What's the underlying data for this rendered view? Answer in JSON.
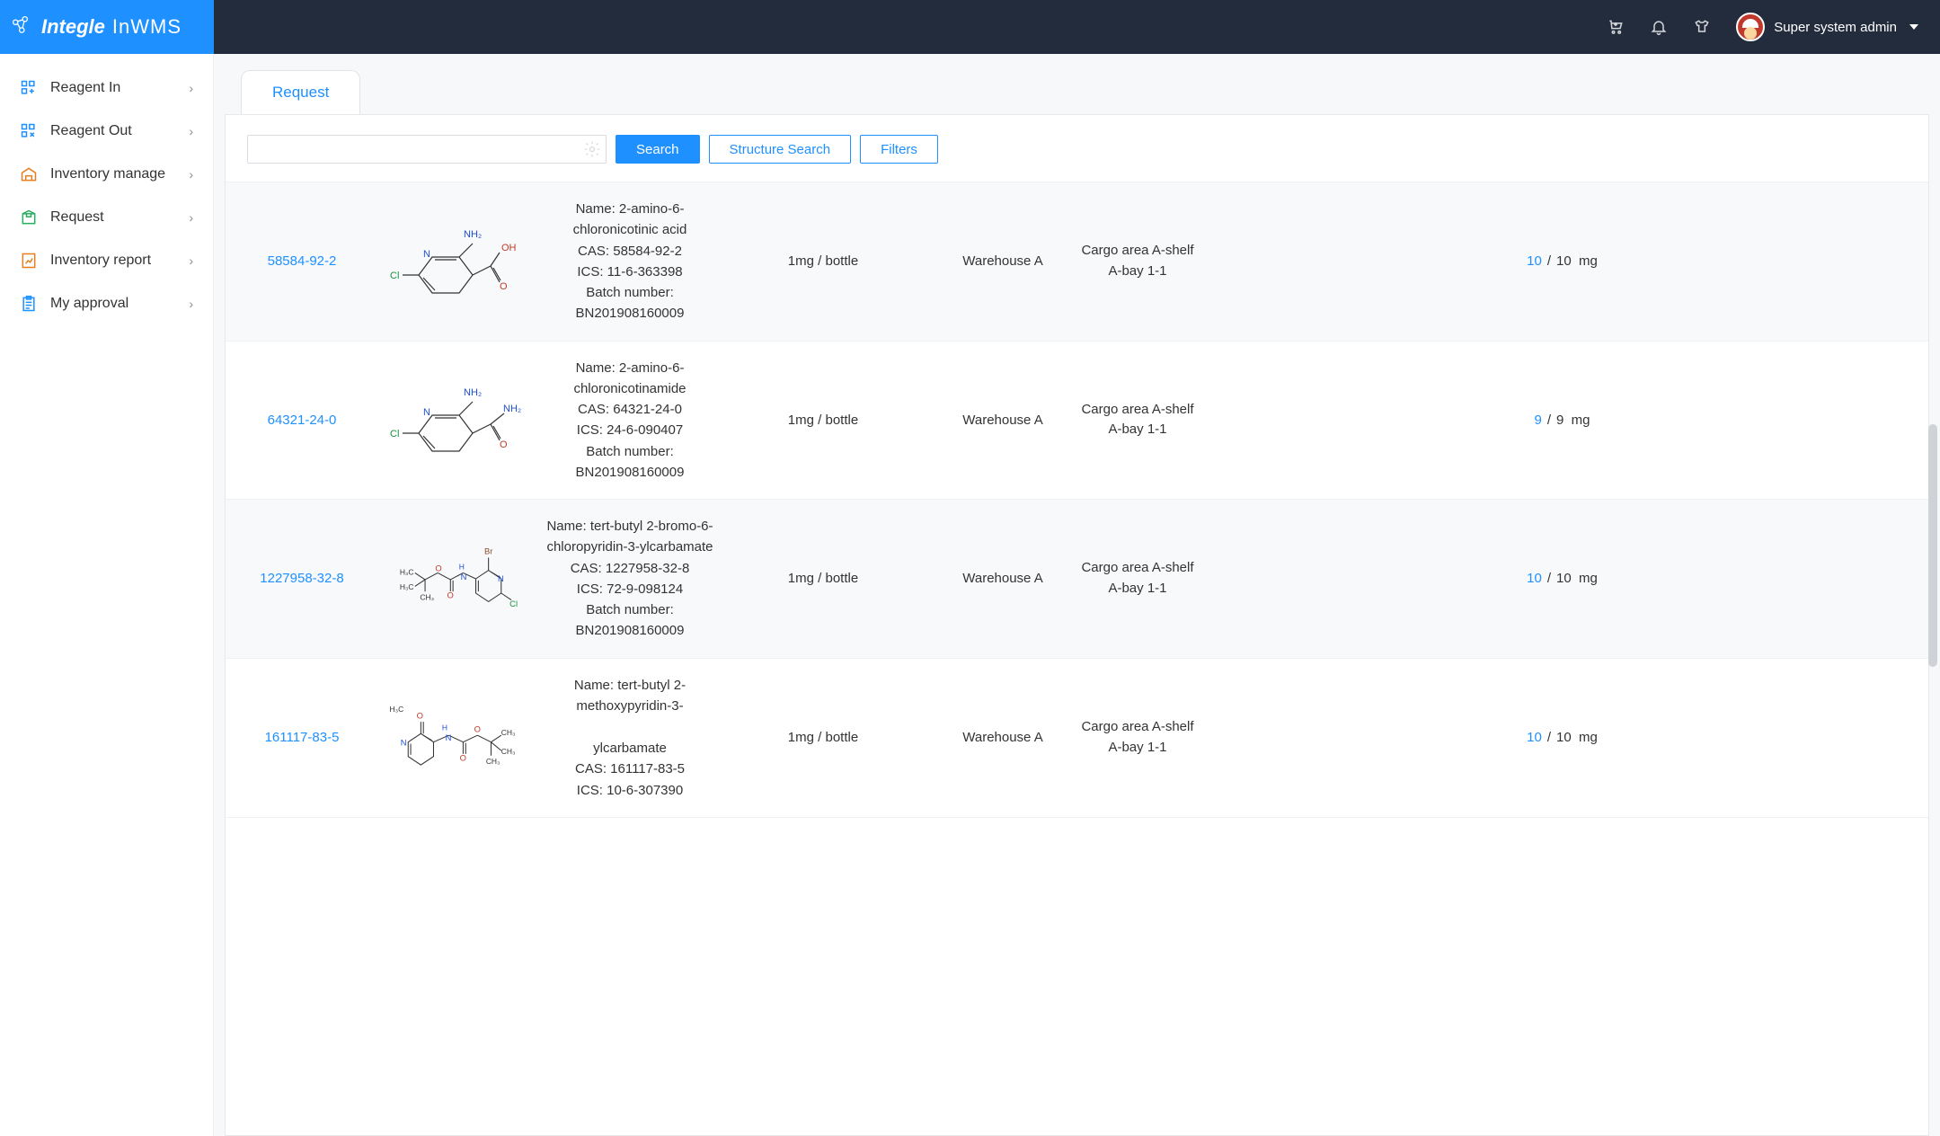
{
  "app": {
    "brand_main": "Integle",
    "brand_sub": "InWMS"
  },
  "header": {
    "user_label": "Super system admin"
  },
  "sidebar": {
    "items": [
      {
        "label": "Reagent In",
        "icon": "grid-in-icon",
        "color": "#1e90ff"
      },
      {
        "label": "Reagent Out",
        "icon": "grid-out-icon",
        "color": "#1e90ff"
      },
      {
        "label": "Inventory manage",
        "icon": "warehouse-icon",
        "color": "#e67e22"
      },
      {
        "label": "Request",
        "icon": "package-icon",
        "color": "#27ae60"
      },
      {
        "label": "Inventory report",
        "icon": "report-icon",
        "color": "#e67e22"
      },
      {
        "label": "My approval",
        "icon": "clipboard-icon",
        "color": "#1e90ff"
      }
    ]
  },
  "tabs": {
    "active": "Request"
  },
  "toolbar": {
    "search_value": "",
    "search_btn": "Search",
    "structure_btn": "Structure Search",
    "filters_btn": "Filters"
  },
  "detail_labels": {
    "name": "Name: ",
    "cas": "CAS: ",
    "ics": "ICS: ",
    "batch": "Batch number: "
  },
  "results": [
    {
      "cas_link": "58584-92-2",
      "struct": 1,
      "name": "2-amino-6-chloronicotinic acid",
      "cas": "58584-92-2",
      "ics": "11-6-363398",
      "batch": "BN201908160009",
      "spec": "1mg / bottle",
      "warehouse": "Warehouse A",
      "location": "Cargo area A-shelf A-bay 1-1",
      "qty_a": "10",
      "qty_b": "10",
      "unit": "mg"
    },
    {
      "cas_link": "64321-24-0",
      "struct": 2,
      "name": "2-amino-6-chloronicotinamide",
      "cas": "64321-24-0",
      "ics": "24-6-090407",
      "batch": "BN201908160009",
      "spec": "1mg / bottle",
      "warehouse": "Warehouse A",
      "location": "Cargo area A-shelf A-bay 1-1",
      "qty_a": "9",
      "qty_b": "9",
      "unit": "mg"
    },
    {
      "cas_link": "1227958-32-8",
      "struct": 3,
      "name": "tert-butyl 2-bromo-6-chloropyridin-3-ylcarbamate",
      "cas": "1227958-32-8",
      "ics": "72-9-098124",
      "batch": "BN201908160009",
      "spec": "1mg / bottle",
      "warehouse": "Warehouse A",
      "location": "Cargo area A-shelf A-bay 1-1",
      "qty_a": "10",
      "qty_b": "10",
      "unit": "mg"
    },
    {
      "cas_link": "161117-83-5",
      "struct": 4,
      "name_line1": "tert-butyl 2-methoxypyridin-3-",
      "name_line2": "ylcarbamate",
      "cas": "161117-83-5",
      "ics": "10-6-307390",
      "batch": "",
      "spec": "1mg / bottle",
      "warehouse": "Warehouse A",
      "location": "Cargo area A-shelf A-bay 1-1",
      "qty_a": "10",
      "qty_b": "10",
      "unit": "mg"
    }
  ]
}
